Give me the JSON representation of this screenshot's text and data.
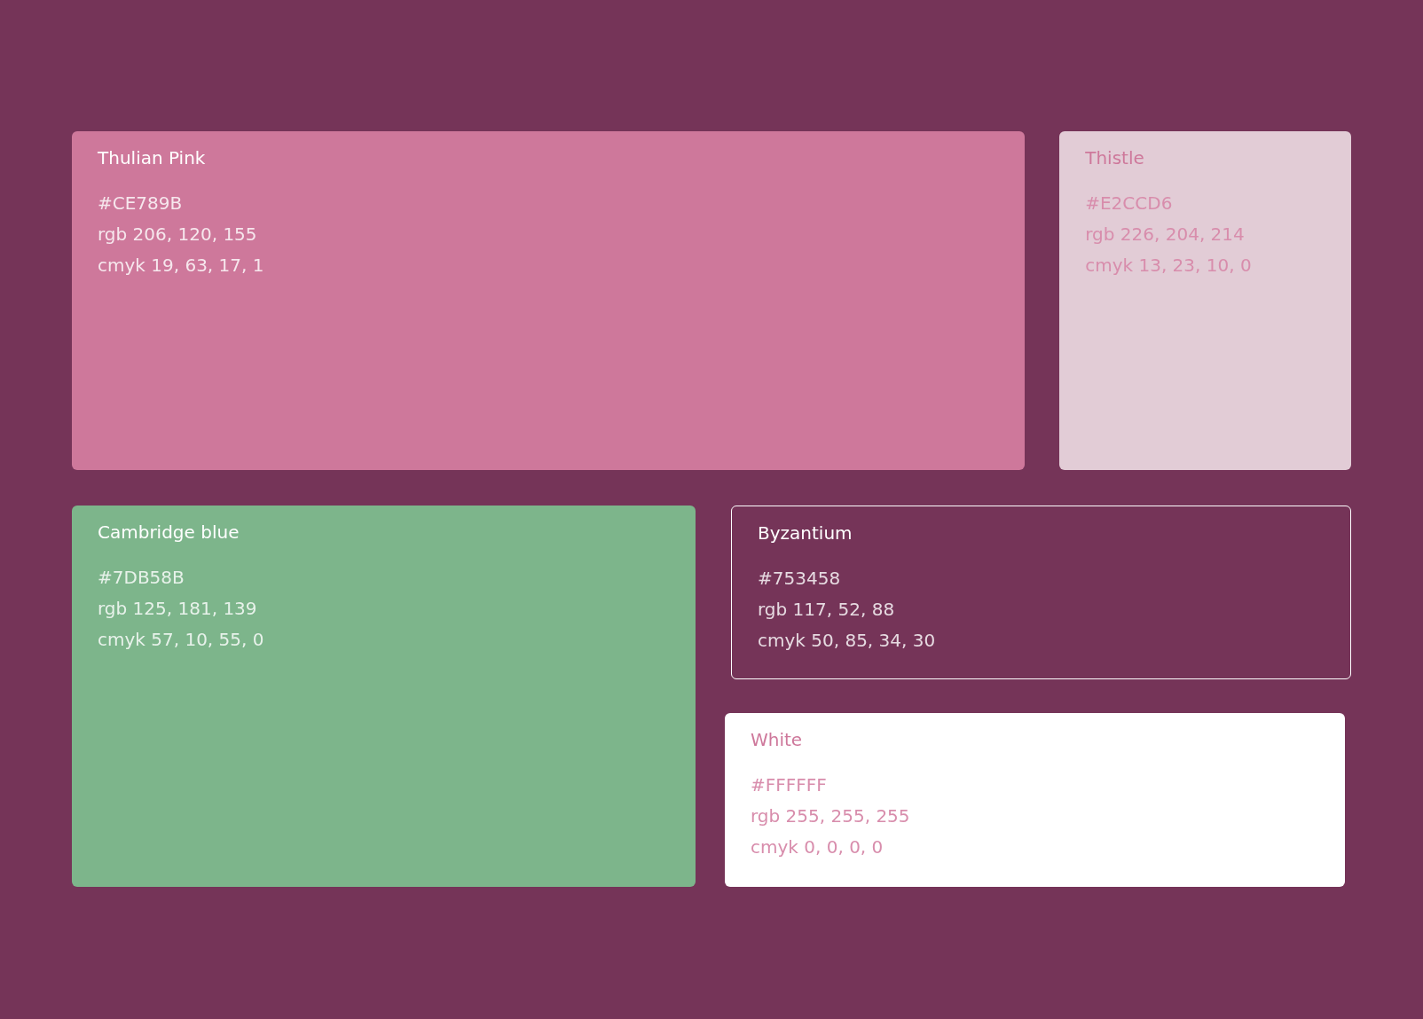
{
  "swatches": [
    {
      "name": "Thulian Pink",
      "hex": "#CE789B",
      "rgb": "rgb 206, 120, 155",
      "cmyk": "cmyk 19, 63, 17, 1",
      "color": "#ce789b",
      "kind": "filled"
    },
    {
      "name": "Thistle",
      "hex": "#E2CCD6",
      "rgb": "rgb 226, 204, 214",
      "cmyk": "cmyk 13, 23, 10, 0",
      "color": "#e2ccd6",
      "kind": "filled"
    },
    {
      "name": "Cambridge blue",
      "hex": "#7DB58B",
      "rgb": "rgb 125, 181, 139",
      "cmyk": "cmyk 57, 10, 55, 0",
      "color": "#7db58b",
      "kind": "filled"
    },
    {
      "name": "Byzantium",
      "hex": "#753458",
      "rgb": "rgb 117, 52, 88",
      "cmyk": "cmyk 50, 85, 34, 30",
      "color": "#753458",
      "kind": "outlined"
    },
    {
      "name": "White",
      "hex": "#FFFFFF",
      "rgb": "rgb 255, 255, 255",
      "cmyk": "cmyk 0, 0, 0, 0",
      "color": "#ffffff",
      "kind": "filled"
    }
  ]
}
